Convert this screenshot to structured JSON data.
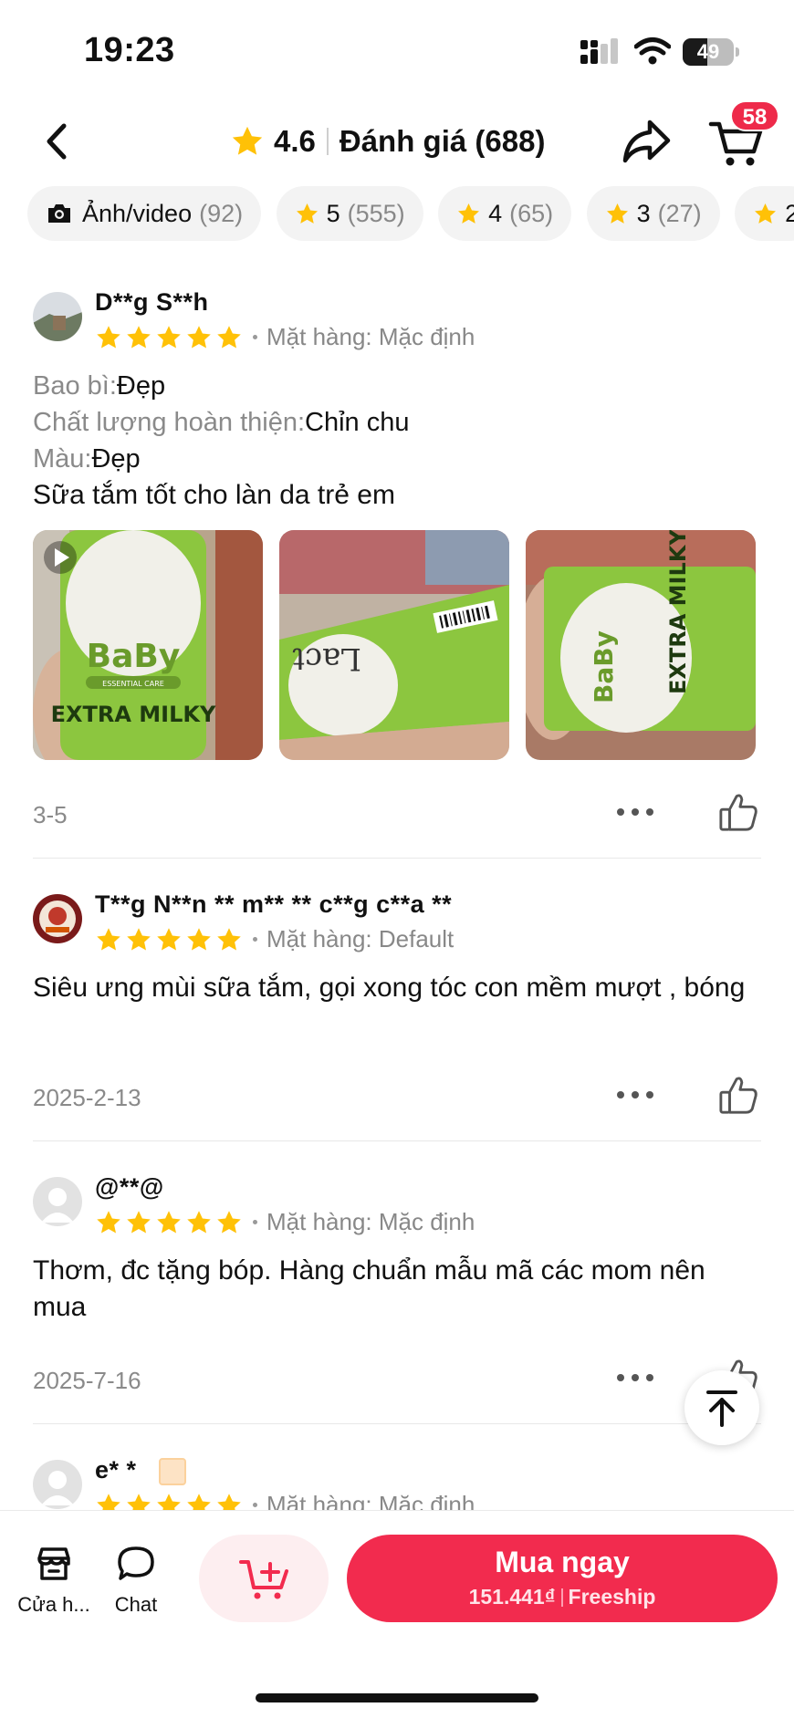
{
  "status_bar": {
    "time": "19:23",
    "battery": "49",
    "battery_level_percent": 49
  },
  "header": {
    "rating": "4.6",
    "label": "Đánh giá (688)",
    "cart_badge": "58"
  },
  "filters": [
    {
      "label": "Ảnh/video",
      "count": "(92)",
      "icon": "camera-icon"
    },
    {
      "label": "5",
      "count": "(555)",
      "icon": "star-icon"
    },
    {
      "label": "4",
      "count": "(65)",
      "icon": "star-icon"
    },
    {
      "label": "3",
      "count": "(27)",
      "icon": "star-icon"
    },
    {
      "label": "2",
      "count": "",
      "icon": "star-icon"
    }
  ],
  "reviews": [
    {
      "name": "D**g S**h",
      "stars": 5,
      "variant": "Mặt hàng: Mặc định",
      "attributes": [
        {
          "key": "Bao bì:",
          "value": "Đẹp"
        },
        {
          "key": "Chất lượng hoàn thiện:",
          "value": "Chỉn chu"
        },
        {
          "key": "Màu:",
          "value": "Đẹp"
        }
      ],
      "text": "Sữa tắm tốt cho làn da trẻ em",
      "photos": [
        {
          "brand": "BaBy",
          "tag": "ESSENTIAL CARE",
          "product": "EXTRA MILKY",
          "has_video": true
        },
        {
          "brand": "Lact",
          "has_video": false
        },
        {
          "brand": "BaBy",
          "product": "EXTRA MILKY",
          "has_video": false
        }
      ],
      "date": "3-5"
    },
    {
      "name": "T**g N**n ** m** ** c**g c**a **",
      "stars": 5,
      "variant": "Mặt hàng: Default",
      "text": "Siêu ưng mùi sữa tắm, gọi xong tóc con mềm mượt , bóng",
      "date": "2025-2-13"
    },
    {
      "name": "@**@",
      "stars": 5,
      "variant": "Mặt hàng: Mặc định",
      "text": "Thơm, đc tặng bóp. Hàng chuẩn mẫu mã các mom nên mua",
      "date": "2025-7-16"
    },
    {
      "name": "e* *",
      "stars": 5,
      "variant": "Mặt hàng: Mặc định"
    }
  ],
  "bottom_bar": {
    "shop_label": "Cửa h...",
    "chat_label": "Chat",
    "buy_label": "Mua ngay",
    "price": "151.441₫",
    "shipping": "Freeship"
  },
  "colors": {
    "accent": "#f22b4e",
    "star": "#ffc107",
    "muted": "#8a8a8a"
  }
}
